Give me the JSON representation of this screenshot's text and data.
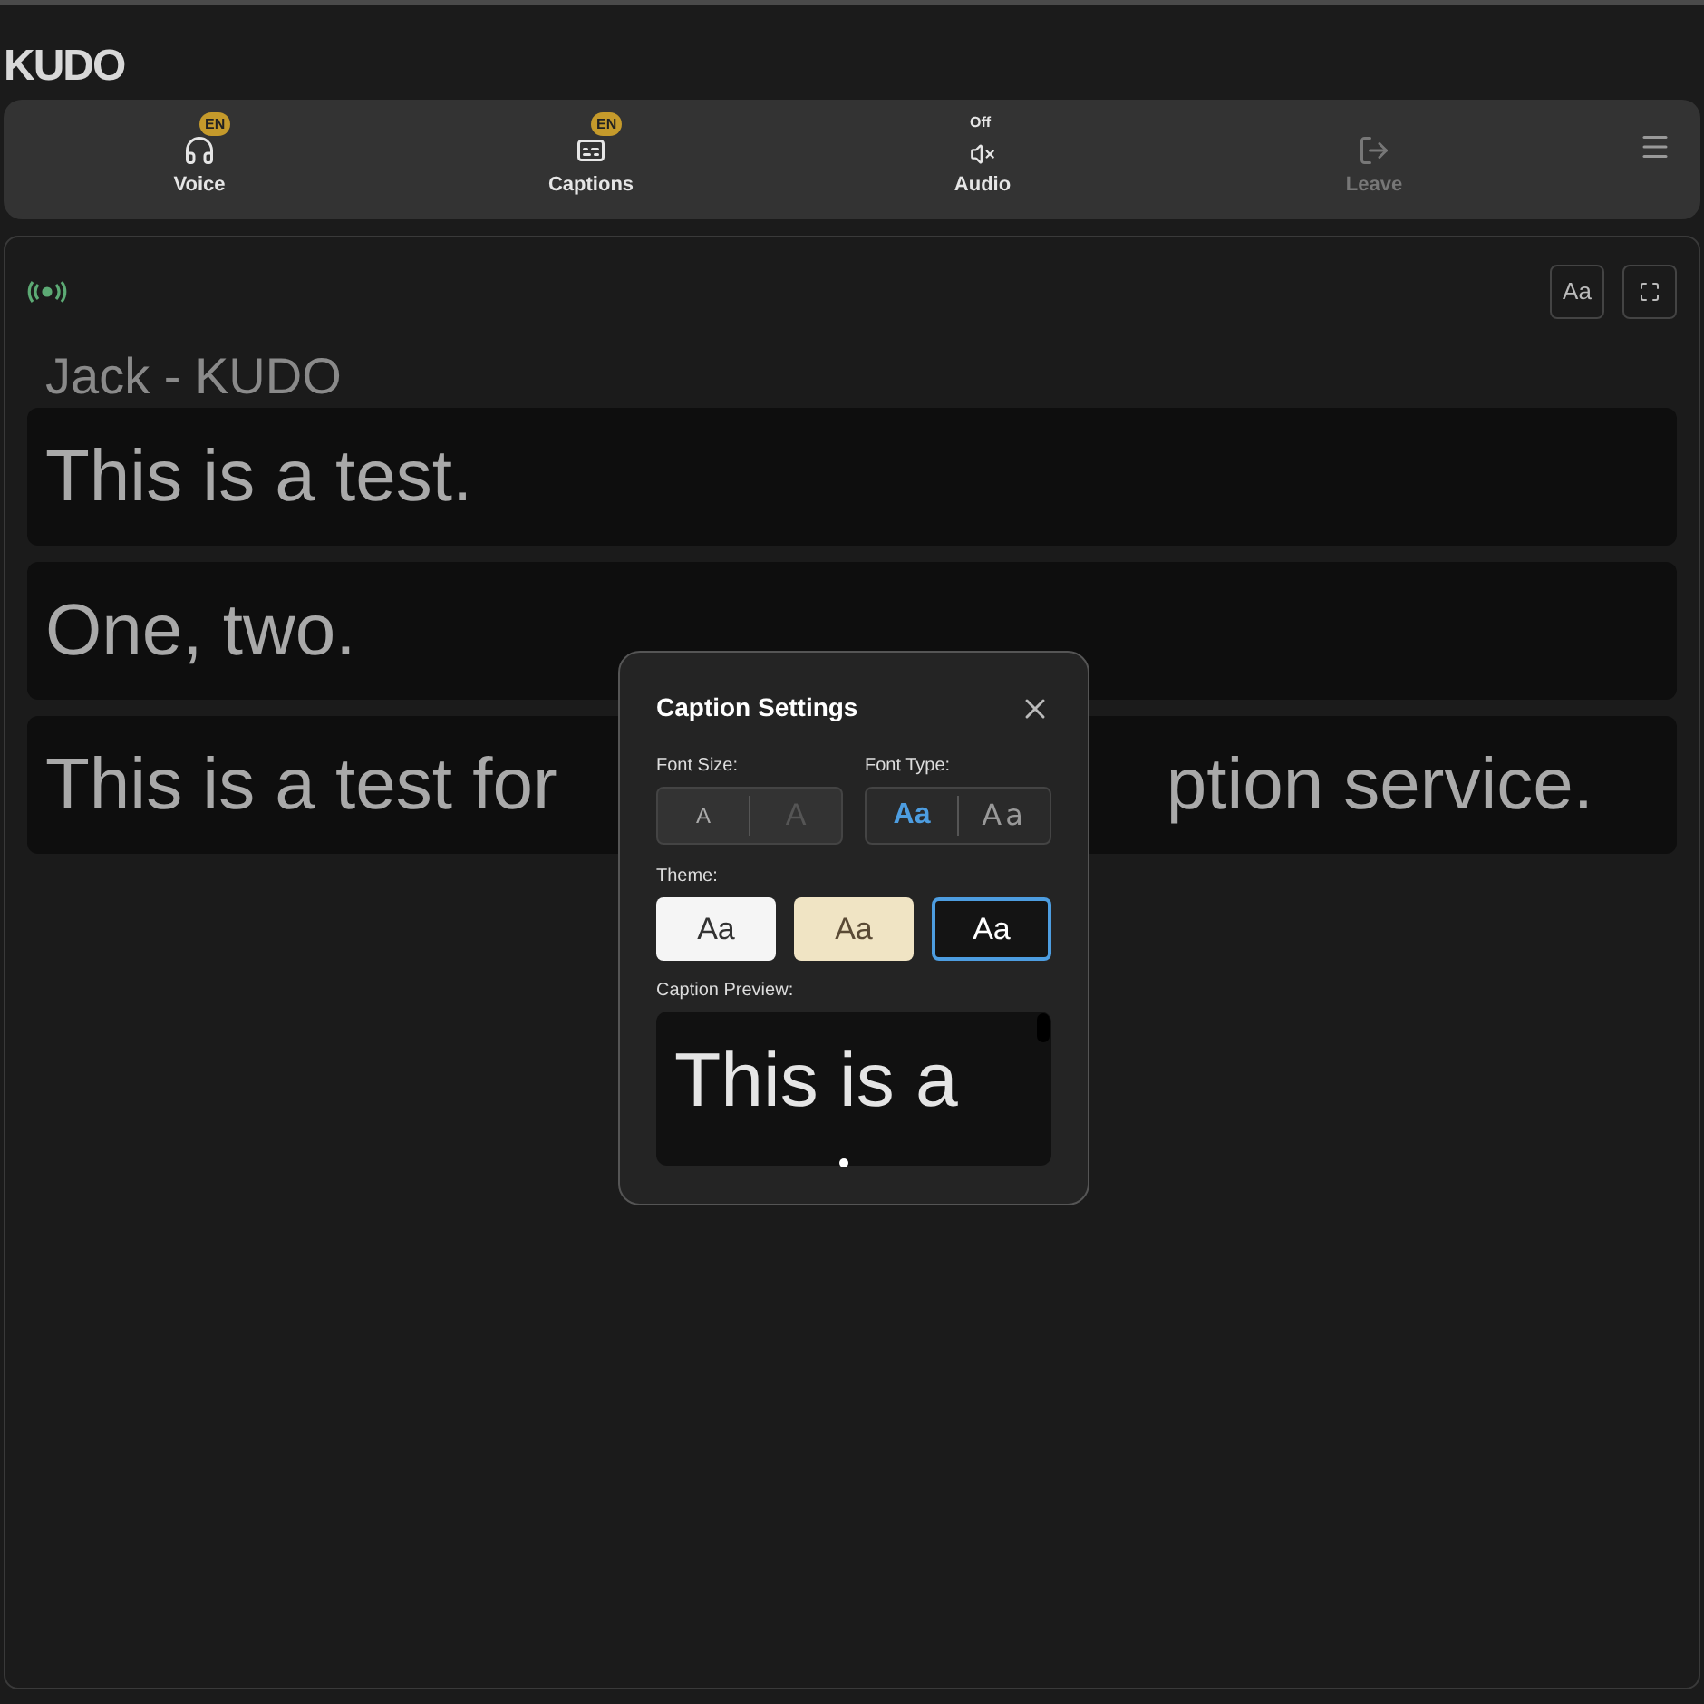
{
  "logo": "KUDO",
  "toolbar": [
    {
      "kind": "voice",
      "label": "Voice",
      "badge": "EN",
      "disabled": false
    },
    {
      "kind": "captions",
      "label": "Captions",
      "badge": "EN",
      "disabled": false
    },
    {
      "kind": "audio",
      "label": "Audio",
      "badge": "Off",
      "disabled": false
    },
    {
      "kind": "leave",
      "label": "Leave",
      "disabled": true
    }
  ],
  "panel": {
    "font_button": "Aa",
    "speaker": "Jack - KUDO",
    "captions": [
      {
        "parts": [
          "This is a test."
        ]
      },
      {
        "parts": [
          "One, two."
        ]
      },
      {
        "parts": [
          "This is a test for",
          "ption service."
        ]
      }
    ]
  },
  "dialog": {
    "title": "Caption Settings",
    "font_size_label": "Font Size:",
    "font_size": [
      {
        "label": "A",
        "selected": true
      },
      {
        "label": "A",
        "selected": false
      }
    ],
    "font_type_label": "Font Type:",
    "font_type": [
      {
        "label": "Aa",
        "selected": true
      },
      {
        "label": "Aa",
        "selected": false
      }
    ],
    "theme_label": "Theme:",
    "themes": [
      {
        "label": "Aa",
        "color": "#f5f5f5",
        "selected": false
      },
      {
        "label": "Aa",
        "color": "#f0e4c4",
        "selected": false
      },
      {
        "label": "Aa",
        "color": "#141414",
        "selected": true
      }
    ],
    "preview_label": "Caption Preview:",
    "preview": "This is a"
  }
}
